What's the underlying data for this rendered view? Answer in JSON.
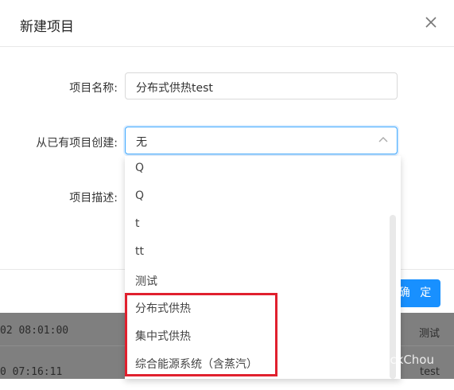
{
  "modal": {
    "title": "新建项目",
    "ok_label": "确 定"
  },
  "form": {
    "name_label": "项目名称:",
    "name_value": "分布式供热test",
    "source_label": "从已有项目创建:",
    "source_value": "无",
    "desc_label": "项目描述:"
  },
  "dropdown": {
    "items": [
      "Q",
      "Q",
      "t",
      "tt",
      "测试",
      "分布式供热",
      "集中式供热",
      "综合能源系统（含蒸汽）"
    ]
  },
  "background_table": {
    "rows": [
      {
        "time": "02 08:01:00",
        "name": "测试"
      },
      {
        "time": "0 07:16:11",
        "name": "test"
      }
    ]
  },
  "watermark": "知乎 @JackChou",
  "colors": {
    "primary": "#1890ff",
    "highlight": "#e0202e"
  }
}
